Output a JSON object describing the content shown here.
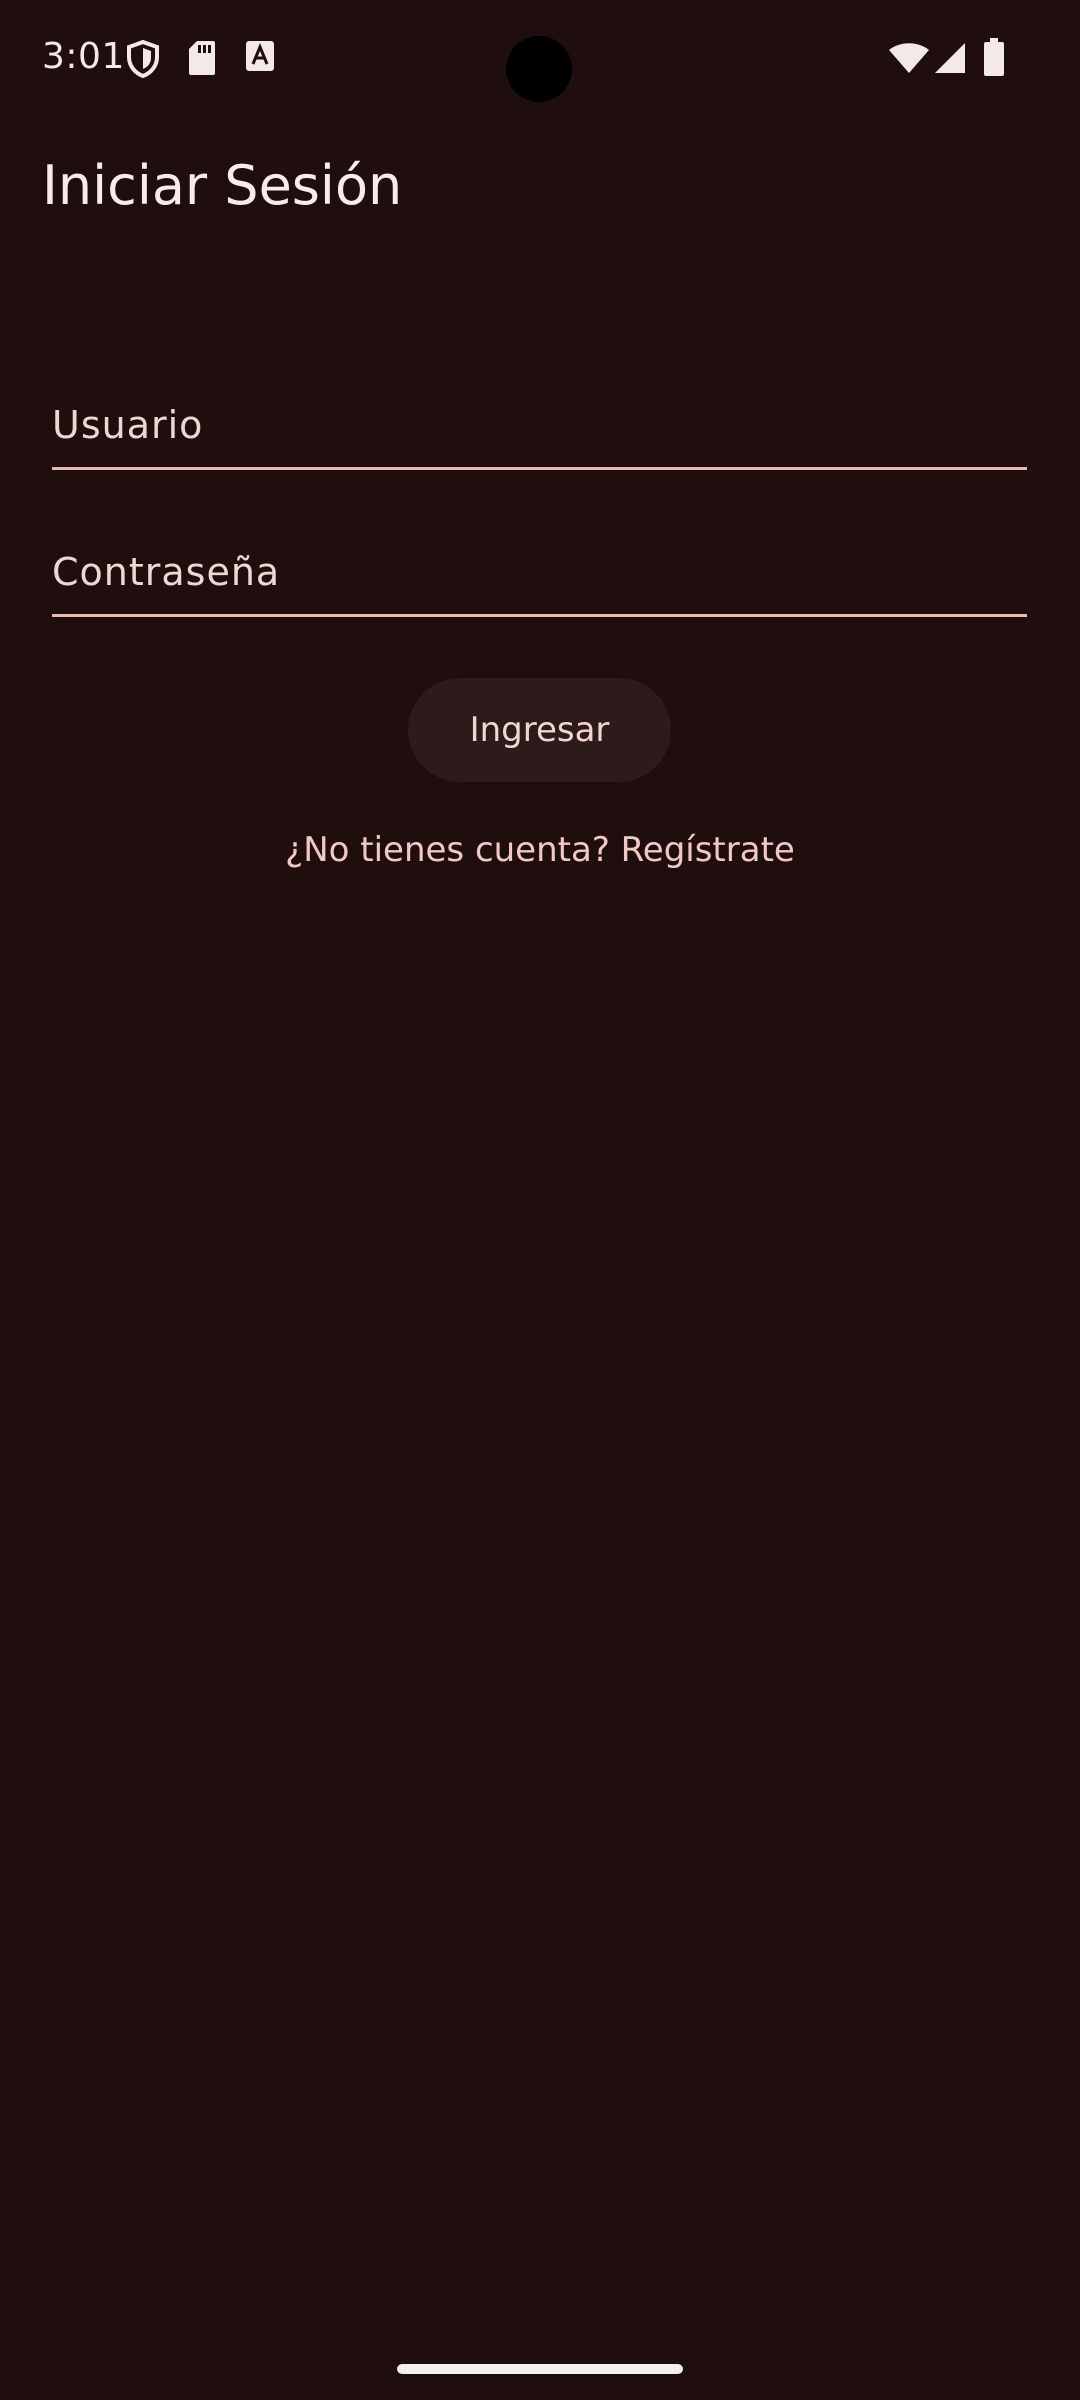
{
  "status_bar": {
    "time": "3:01",
    "left_icons": [
      "shield-icon",
      "sd-card-icon",
      "font-a-icon"
    ],
    "right_icons": [
      "wifi-icon",
      "signal-icon",
      "battery-icon"
    ]
  },
  "login": {
    "title": "Iniciar Sesión",
    "username_placeholder": "Usuario",
    "password_placeholder": "Contraseña",
    "submit_label": "Ingresar",
    "register_link": "¿No tienes cuenta? Regístrate"
  },
  "colors": {
    "background": "#200d0e",
    "accent": "#e6b9b5",
    "button_bg": "#2d1a1b"
  }
}
